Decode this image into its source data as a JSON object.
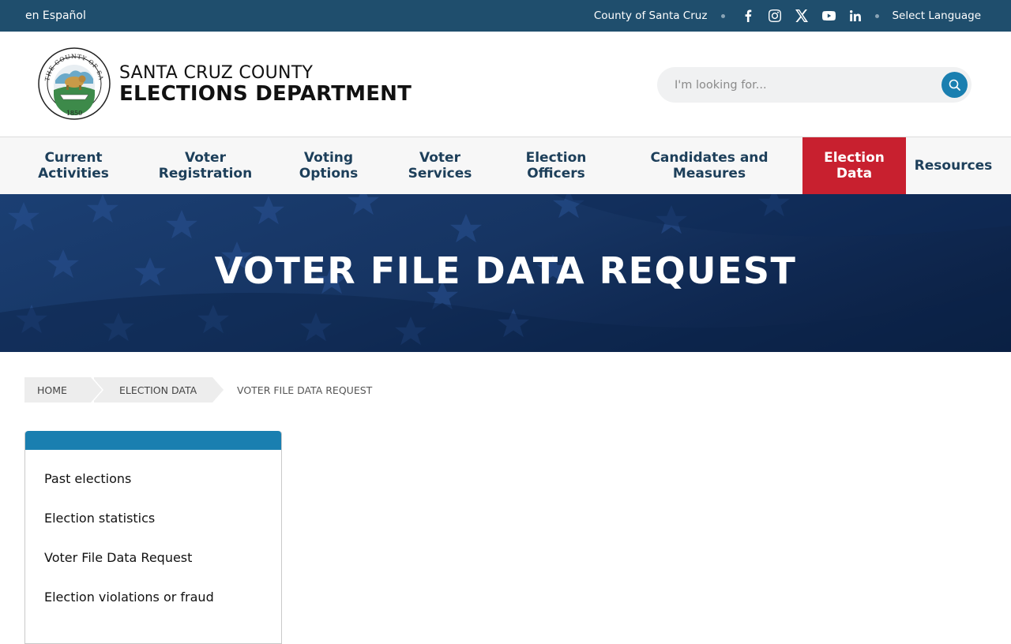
{
  "topbar": {
    "language_link": "en Español",
    "county_link": "County of Santa Cruz",
    "social": [
      "facebook-icon",
      "instagram-icon",
      "x-icon",
      "youtube-icon",
      "linkedin-icon"
    ],
    "select_language": "Select Language"
  },
  "header": {
    "brand_line1": "SANTA CRUZ COUNTY",
    "brand_line2": "ELECTIONS DEPARTMENT",
    "seal": {
      "top_text": "THE COUNTY OF SANTA CRUZ",
      "year": "1850"
    },
    "search": {
      "placeholder": "I'm looking for...",
      "value": ""
    }
  },
  "nav": {
    "items": [
      {
        "line1": "Current",
        "line2": "Activities"
      },
      {
        "line1": "Voter",
        "line2": "Registration"
      },
      {
        "line1": "Voting",
        "line2": "Options"
      },
      {
        "line1": "Voter",
        "line2": "Services"
      },
      {
        "line1": "Election",
        "line2": "Officers"
      },
      {
        "line1": "Candidates and",
        "line2": "Measures"
      },
      {
        "line1": "Election",
        "line2": "Data"
      },
      {
        "line1": "Resources",
        "line2": ""
      }
    ],
    "active_index": 6
  },
  "hero": {
    "title": "VOTER FILE DATA REQUEST"
  },
  "breadcrumb": {
    "items": [
      "HOME",
      "ELECTION DATA",
      "VOTER FILE DATA REQUEST"
    ]
  },
  "sidenav": {
    "items": [
      "Past elections",
      "Election statistics",
      "Voter File Data Request",
      "Election violations or fraud"
    ]
  },
  "colors": {
    "topbar": "#1f4e6d",
    "nav_text": "#1d3f5a",
    "active_nav": "#c8202f",
    "accent": "#1a7fb0",
    "hero": "#163462"
  }
}
